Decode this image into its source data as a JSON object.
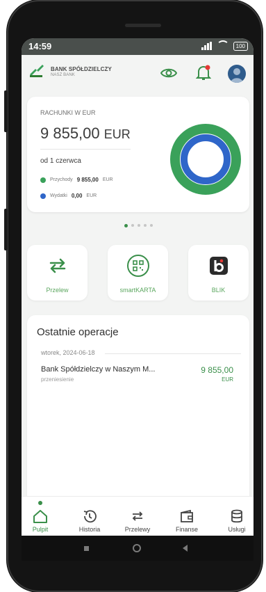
{
  "status_bar": {
    "time": "14:59",
    "battery": "100"
  },
  "header": {
    "bank_name": "BANK SPÓŁDZIELCZY",
    "bank_subtitle": "NASZ BANK",
    "icons": [
      "visibility-eye-icon",
      "notification-bell-icon",
      "avatar"
    ],
    "notification_color": "#e53935"
  },
  "account_card": {
    "label": "RACHUNKI W EUR",
    "amount": "9 855,00",
    "currency": "EUR",
    "period": "od 1 czerwca",
    "legend": [
      {
        "label": "Przychody",
        "value": "9 855,00",
        "unit": "EUR",
        "color": "#3aa15a"
      },
      {
        "label": "Wydatki",
        "value": "0,00",
        "unit": "EUR",
        "color": "#2f66c9"
      }
    ]
  },
  "pager": {
    "count": 5,
    "active_index": 0
  },
  "actions": [
    {
      "label": "Przelew",
      "icon": "transfer-arrows-icon"
    },
    {
      "label": "smartKARTA",
      "icon": "qr-card-icon"
    },
    {
      "label": "BLIK",
      "icon": "blik-icon"
    }
  ],
  "operations": {
    "title": "Ostatnie operacje",
    "date": "wtorek, 2024-06-18",
    "items": [
      {
        "name": "Bank Spółdzielczy w Naszym M...",
        "type": "przeniesienie",
        "amount": "9 855,00",
        "currency": "EUR"
      }
    ]
  },
  "bottom_nav": [
    {
      "label": "Pulpit",
      "icon": "home-icon",
      "active": true
    },
    {
      "label": "Historia",
      "icon": "history-icon",
      "active": false
    },
    {
      "label": "Przelewy",
      "icon": "transfers-icon",
      "active": false
    },
    {
      "label": "Finanse",
      "icon": "wallet-icon",
      "active": false
    },
    {
      "label": "Usługi",
      "icon": "database-icon",
      "active": false
    }
  ],
  "colors": {
    "accent": "#3a8f4a",
    "expense": "#2f66c9",
    "income": "#3aa15a"
  }
}
